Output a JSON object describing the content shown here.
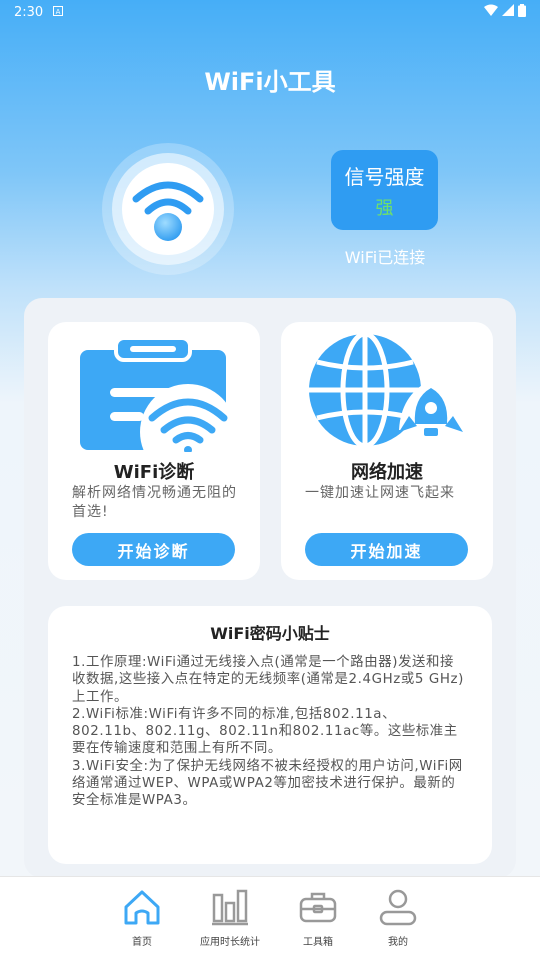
{
  "status_bar": {
    "time": "2:30"
  },
  "header": {
    "title": "WiFi小工具"
  },
  "signal": {
    "title": "信号强度",
    "value": "强",
    "connection_status": "WiFi已连接"
  },
  "features": [
    {
      "title": "WiFi诊断",
      "description": "解析网络情况畅通无阻的首选!",
      "button": "开始诊断"
    },
    {
      "title": "网络加速",
      "description": "一键加速让网速飞起来",
      "button": "开始加速"
    }
  ],
  "tips": {
    "title": "WiFi密码小贴士",
    "paragraphs": [
      "1.工作原理:WiFi通过无线接入点(通常是一个路由器)发送和接收数据,这些接入点在特定的无线频率(通常是2.4GHz或5 GHz)上工作。",
      "2.WiFi标准:WiFi有许多不同的标准,包括802.11a、802.11b、802.11g、802.11n和802.11ac等。这些标准主要在传输速度和范围上有所不同。",
      "3.WiFi安全:为了保护无线网络不被未经授权的用户访问,WiFi网络通常通过WEP、WPA或WPA2等加密技术进行保护。最新的安全标准是WPA3。"
    ]
  },
  "nav": [
    {
      "label": "首页",
      "icon": "home-icon",
      "active": true
    },
    {
      "label": "应用时长统计",
      "icon": "bar-chart-icon",
      "active": false
    },
    {
      "label": "工具箱",
      "icon": "toolbox-icon",
      "active": false
    },
    {
      "label": "我的",
      "icon": "user-icon",
      "active": false
    }
  ],
  "colors": {
    "accent": "#3da8f5",
    "signal_card": "#2f9cf2",
    "signal_good": "#6fe06a",
    "nav_active": "#3da8f5"
  }
}
